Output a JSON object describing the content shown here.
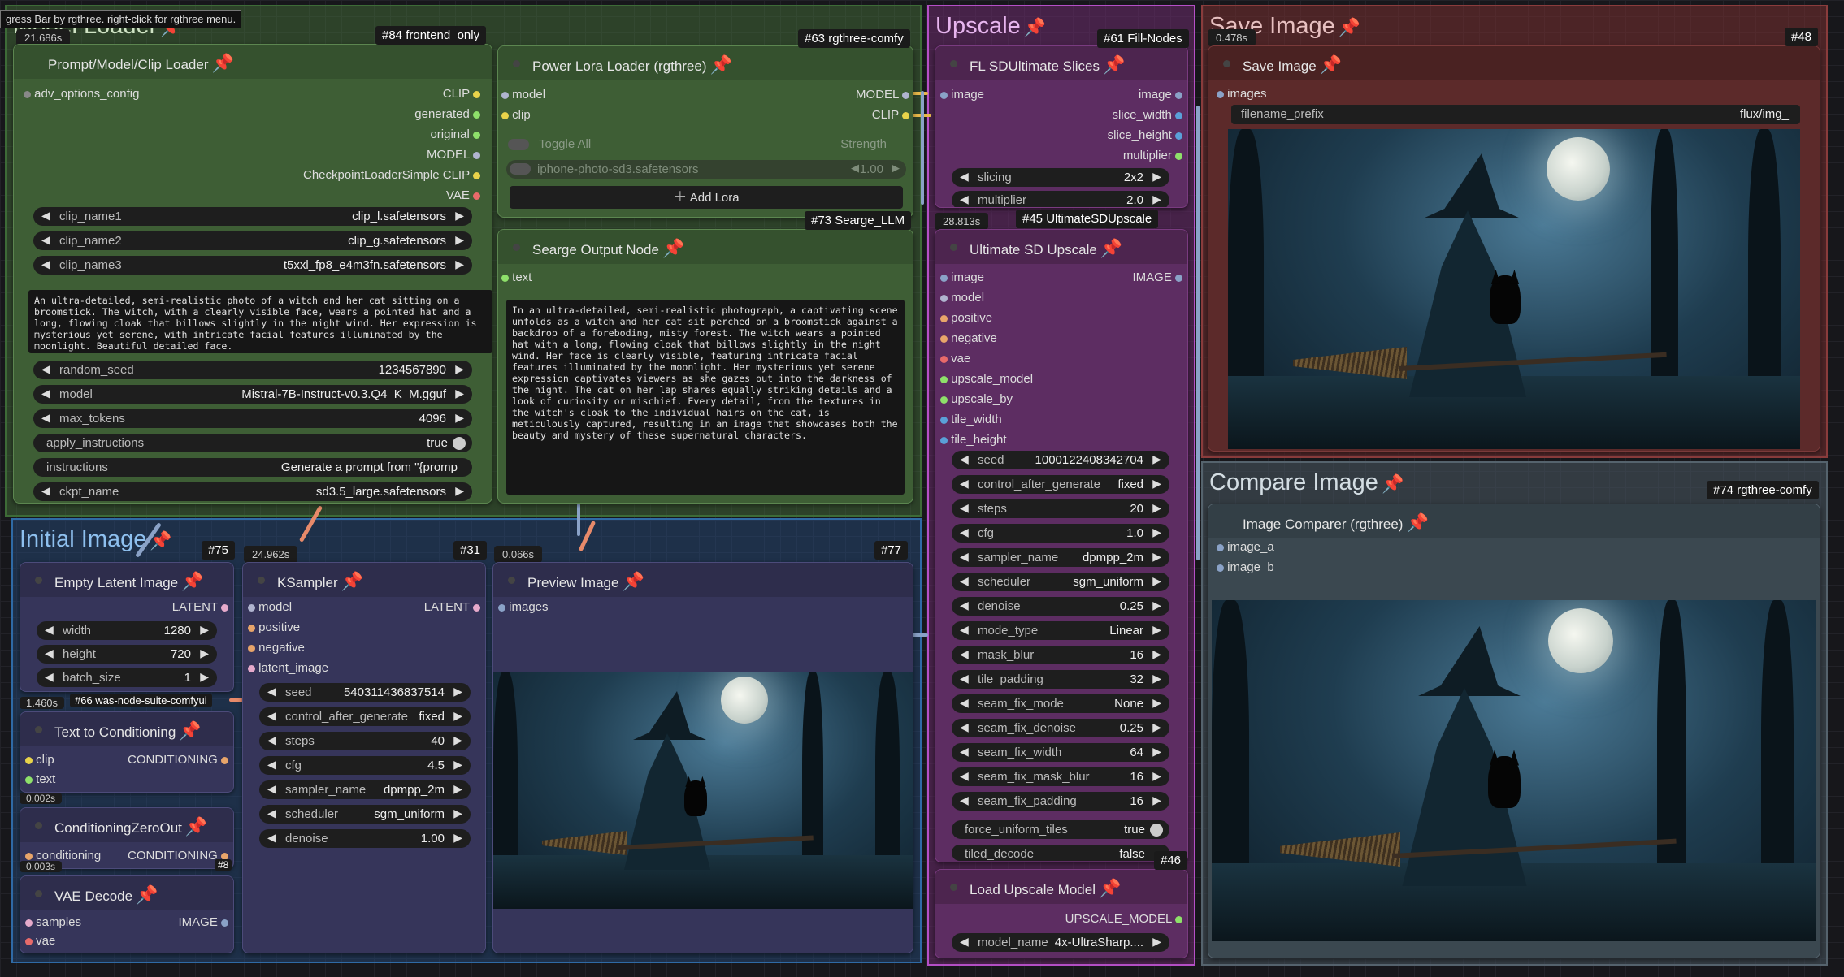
{
  "tooltip": "gress Bar by rgthree. right-click for rgthree menu.",
  "groups": {
    "loader": {
      "title": "Model Loader",
      "color": "#3d6b37"
    },
    "upscale": {
      "title": "Upscale",
      "color": "#a04bb0"
    },
    "save": {
      "title": "Save Image",
      "color": "#8a3c3c"
    },
    "compare": {
      "title": "Compare Image",
      "color": "#55636d"
    },
    "initial": {
      "title": "Initial Image",
      "color": "#2f6aa5"
    }
  },
  "timers": {
    "t1": "21.686s",
    "t2": "28.813s",
    "t3": "0.478s",
    "t4": "24.962s",
    "t5": "0.066s",
    "t6": "1.460s",
    "t7": "0.002s",
    "t8": "0.003s"
  },
  "prompt_node": {
    "badge": "#84 frontend_only",
    "title": "Prompt/Model/Clip Loader",
    "input": "adv_options_config",
    "outputs": [
      "CLIP",
      "generated",
      "original",
      "MODEL",
      "CheckpointLoaderSimple CLIP",
      "VAE"
    ],
    "widgets": [
      {
        "label": "clip_name1",
        "value": "clip_l.safetensors"
      },
      {
        "label": "clip_name2",
        "value": "clip_g.safetensors"
      },
      {
        "label": "clip_name3",
        "value": "t5xxl_fp8_e4m3fn.safetensors"
      }
    ],
    "prompt": "An ultra-detailed, semi-realistic photo of a witch and her cat sitting on a broomstick. The witch, with a clearly visible face, wears a pointed hat and a long, flowing cloak that billows slightly in the night wind. Her expression is mysterious yet serene, with intricate facial features illuminated by the moonlight. Beautiful detailed face.",
    "widgets2": [
      {
        "label": "random_seed",
        "value": "1234567890"
      },
      {
        "label": "model",
        "value": "Mistral-7B-Instruct-v0.3.Q4_K_M.gguf"
      },
      {
        "label": "max_tokens",
        "value": "4096"
      }
    ],
    "apply_instructions": {
      "label": "apply_instructions",
      "value": "true"
    },
    "instructions": {
      "label": "instructions",
      "value": "Generate a prompt from \"{promp"
    },
    "ckpt": {
      "label": "ckpt_name",
      "value": "sd3.5_large.safetensors"
    }
  },
  "lora_node": {
    "badge": "#63 rgthree-comfy",
    "title": "Power Lora Loader (rgthree)",
    "inputs": [
      "model",
      "clip"
    ],
    "outputs": [
      "MODEL",
      "CLIP"
    ],
    "toggle_all": "Toggle All",
    "strength": "Strength",
    "lora_name": "iphone-photo-sd3.safetensors",
    "lora_strength": "1.00",
    "add_lora": "Add Lora"
  },
  "searge_node": {
    "badge": "#73 Searge_LLM",
    "title": "Searge Output Node",
    "input": "text",
    "text": "In an ultra-detailed, semi-realistic photograph, a captivating scene unfolds as a witch and her cat sit perched on a broomstick against a backdrop of a foreboding, misty forest. The witch wears a pointed hat with a long, flowing cloak that billows slightly in the night wind. Her face is clearly visible, featuring intricate facial features illuminated by the moonlight. Her mysterious yet serene expression captivates viewers as she gazes out into the darkness of the night. The cat on her lap shares equally striking details and a look of curiosity or mischief. Every detail, from the textures in the witch's cloak to the individual hairs on the cat, is meticulously captured, resulting in an image that showcases both the beauty and mystery of these supernatural characters."
  },
  "slices_node": {
    "badge": "#61 Fill-Nodes",
    "title": "FL SDUltimate Slices",
    "input": "image",
    "outputs": [
      "image",
      "slice_width",
      "slice_height",
      "multiplier"
    ],
    "widgets": [
      {
        "label": "slicing",
        "value": "2x2"
      },
      {
        "label": "multiplier",
        "value": "2.0"
      }
    ]
  },
  "usd_node": {
    "badge": "#45 UltimateSDUpscale",
    "title": "Ultimate SD Upscale",
    "inputs": [
      "image",
      "model",
      "positive",
      "negative",
      "vae",
      "upscale_model",
      "upscale_by",
      "tile_width",
      "tile_height"
    ],
    "output": "IMAGE",
    "widgets": [
      {
        "label": "seed",
        "value": "1000122408342704"
      },
      {
        "label": "control_after_generate",
        "value": "fixed"
      },
      {
        "label": "steps",
        "value": "20"
      },
      {
        "label": "cfg",
        "value": "1.0"
      },
      {
        "label": "sampler_name",
        "value": "dpmpp_2m"
      },
      {
        "label": "scheduler",
        "value": "sgm_uniform"
      },
      {
        "label": "denoise",
        "value": "0.25"
      },
      {
        "label": "mode_type",
        "value": "Linear"
      },
      {
        "label": "mask_blur",
        "value": "16"
      },
      {
        "label": "tile_padding",
        "value": "32"
      },
      {
        "label": "seam_fix_mode",
        "value": "None"
      },
      {
        "label": "seam_fix_denoise",
        "value": "0.25"
      },
      {
        "label": "seam_fix_width",
        "value": "64"
      },
      {
        "label": "seam_fix_mask_blur",
        "value": "16"
      },
      {
        "label": "seam_fix_padding",
        "value": "16"
      }
    ],
    "force_uniform": {
      "label": "force_uniform_tiles",
      "value": "true"
    },
    "tiled_decode": {
      "label": "tiled_decode",
      "value": "false"
    }
  },
  "load_upscale_node": {
    "badge": "#46",
    "title": "Load Upscale Model",
    "output": "UPSCALE_MODEL",
    "widget": {
      "label": "model_name",
      "value": "4x-UltraSharp...."
    }
  },
  "save_node": {
    "badge": "#48",
    "title": "Save Image",
    "input": "images",
    "widget": {
      "label": "filename_prefix",
      "value": "flux/img_"
    }
  },
  "compare_node": {
    "badge": "#74 rgthree-comfy",
    "title": "Image Comparer (rgthree)",
    "inputs": [
      "image_a",
      "image_b"
    ]
  },
  "latent_node": {
    "badge": "#75",
    "title": "Empty Latent Image",
    "output": "LATENT",
    "widgets": [
      {
        "label": "width",
        "value": "1280"
      },
      {
        "label": "height",
        "value": "720"
      },
      {
        "label": "batch_size",
        "value": "1"
      }
    ]
  },
  "ksampler_node": {
    "badge": "#31",
    "title": "KSampler",
    "inputs": [
      "model",
      "positive",
      "negative",
      "latent_image"
    ],
    "output": "LATENT",
    "widgets": [
      {
        "label": "seed",
        "value": "540311436837514"
      },
      {
        "label": "control_after_generate",
        "value": "fixed"
      },
      {
        "label": "steps",
        "value": "40"
      },
      {
        "label": "cfg",
        "value": "4.5"
      },
      {
        "label": "sampler_name",
        "value": "dpmpp_2m"
      },
      {
        "label": "scheduler",
        "value": "sgm_uniform"
      },
      {
        "label": "denoise",
        "value": "1.00"
      }
    ]
  },
  "preview_node": {
    "badge": "#77",
    "title": "Preview Image",
    "input": "images"
  },
  "textcond_node": {
    "badge": "#66 was-node-suite-comfyui",
    "title": "Text to Conditioning",
    "inputs": [
      "clip",
      "text"
    ],
    "output": "CONDITIONING"
  },
  "zeroout_node": {
    "badge": "#8",
    "title": "ConditioningZeroOut",
    "input": "conditioning",
    "output": "CONDITIONING"
  },
  "vaedecode_node": {
    "badge": "#8",
    "title": "VAE Decode",
    "inputs": [
      "samples",
      "vae"
    ],
    "output": "IMAGE"
  }
}
